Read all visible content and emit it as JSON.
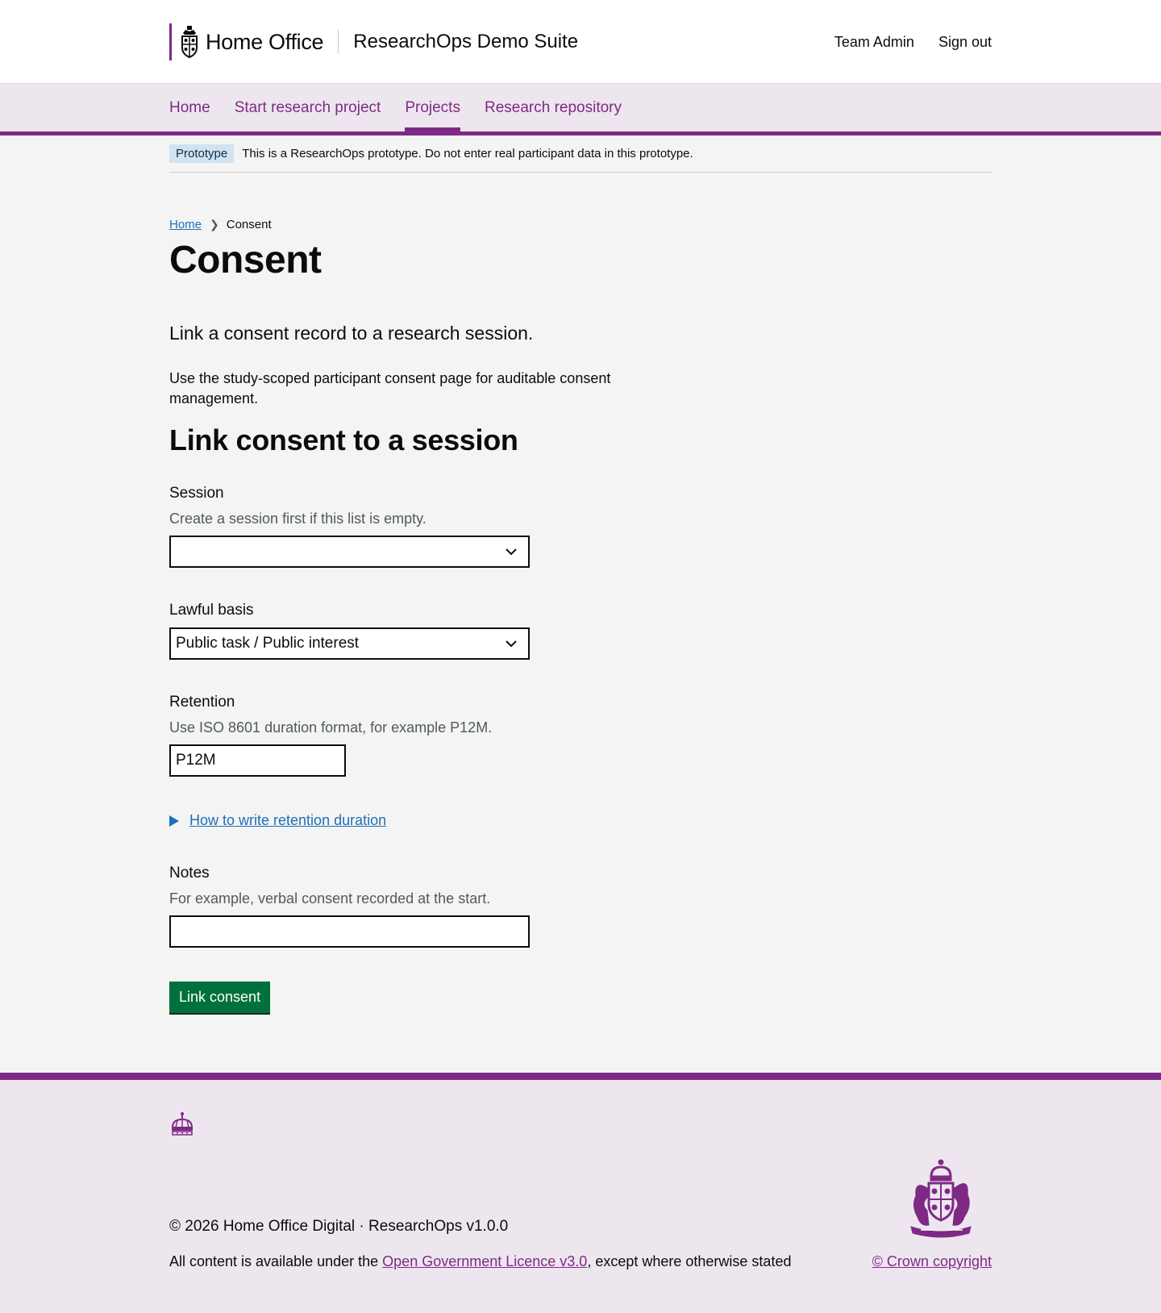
{
  "header": {
    "org_name": "Home Office",
    "service_name": "ResearchOps Demo Suite",
    "links": [
      {
        "label": "Team Admin"
      },
      {
        "label": "Sign out"
      }
    ]
  },
  "nav": {
    "items": [
      {
        "label": "Home",
        "active": false
      },
      {
        "label": "Start research project",
        "active": false
      },
      {
        "label": "Projects",
        "active": true
      },
      {
        "label": "Research repository",
        "active": false
      }
    ]
  },
  "phase_banner": {
    "tag": "Prototype",
    "text": "This is a ResearchOps prototype. Do not enter real participant data in this prototype."
  },
  "breadcrumb": {
    "home": "Home",
    "current": "Consent"
  },
  "page": {
    "title": "Consent",
    "lead": "Link a consent record to a research session.",
    "body": "Use the study-scoped participant consent page for auditable consent management.",
    "section_title": "Link consent to a session"
  },
  "form": {
    "session": {
      "label": "Session",
      "hint": "Create a session first if this list is empty.",
      "value": ""
    },
    "lawful_basis": {
      "label": "Lawful basis",
      "value": "Public task / Public interest"
    },
    "retention": {
      "label": "Retention",
      "hint": "Use ISO 8601 duration format, for example P12M.",
      "value": "P12M"
    },
    "details_summary": "How to write retention duration",
    "notes": {
      "label": "Notes",
      "hint": "For example, verbal consent recorded at the start.",
      "value": ""
    },
    "submit_label": "Link consent"
  },
  "footer": {
    "meta": "© 2026 Home Office Digital · ResearchOps v1.0.0",
    "licence_prefix": "All content is available under the ",
    "licence_link": "Open Government Licence v3.0",
    "licence_suffix": ", except where otherwise stated",
    "copyright": "© Crown copyright"
  },
  "colors": {
    "brand": "#7e2a85",
    "link": "#1d70b8",
    "button": "#00703c",
    "nav_background": "#eee6ef",
    "page_background": "#f4f4f4",
    "tag_background": "#d2e2f1"
  },
  "icons": {
    "header_crest": "royal-crest-icon",
    "select_caret": "chevron-down-icon",
    "details_toggle": "triangle-right-icon",
    "footer_crown": "crown-icon",
    "footer_coat_of_arms": "coat-of-arms-icon"
  }
}
